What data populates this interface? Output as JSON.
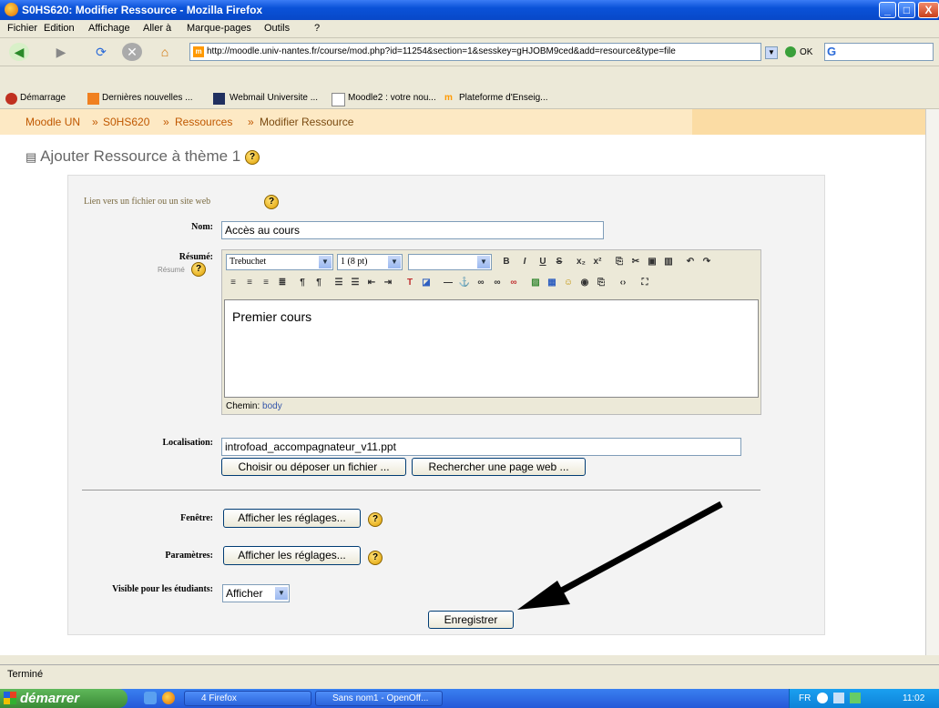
{
  "window": {
    "title": "S0HS620: Modifier Ressource - Mozilla Firefox",
    "minimize": "_",
    "maximize": "□",
    "close": "X"
  },
  "menu": [
    "Fichier",
    "Edition",
    "Affichage",
    "Aller à",
    "Marque-pages",
    "Outils",
    "?"
  ],
  "nav": {
    "url": "http://moodle.univ-nantes.fr/course/mod.php?id=11254&section=1&sesskey=gHJOBM9ced&add=resource&type=file",
    "go_label": "OK"
  },
  "bookmarks": [
    "Démarrage",
    "Dernières nouvelles ...",
    "Webmail Universite ...",
    "Moodle2 : votre nou...",
    "Plateforme d'Enseig..."
  ],
  "breadcrumb": {
    "home": "Moodle UN",
    "sep": "»",
    "course": "S0HS620",
    "section": "Ressources",
    "page": "Modifier Ressource"
  },
  "page": {
    "title": "Ajouter Ressource à thème 1",
    "help": "?"
  },
  "form": {
    "header": "Lien vers un fichier ou un site web",
    "nom_label": "Nom:",
    "nom_value": "Accès au cours",
    "resume_label": "Résumé:",
    "resume_sublabel": "Résumé",
    "editor": {
      "font": "Trebuchet",
      "size": "1 (8 pt)",
      "content": "Premier cours",
      "path_label": "Chemin:",
      "path_value": "body"
    },
    "localisation_label": "Localisation:",
    "localisation_value": "introfoad_accompagnateur_v11.ppt",
    "choose_file": "Choisir ou déposer un fichier ...",
    "search_web": "Rechercher une page web ...",
    "fenetre_label": "Fenêtre:",
    "fenetre_btn": "Afficher les réglages...",
    "params_label": "Paramètres:",
    "params_btn": "Afficher les réglages...",
    "visible_label": "Visible pour les étudiants:",
    "visible_value": "Afficher",
    "submit": "Enregistrer"
  },
  "status": "Terminé",
  "taskbar": {
    "start": "démarrer",
    "tasks": [
      "4 Firefox",
      "Sans nom1 - OpenOff..."
    ],
    "lang": "FR",
    "clock": "11:02"
  }
}
